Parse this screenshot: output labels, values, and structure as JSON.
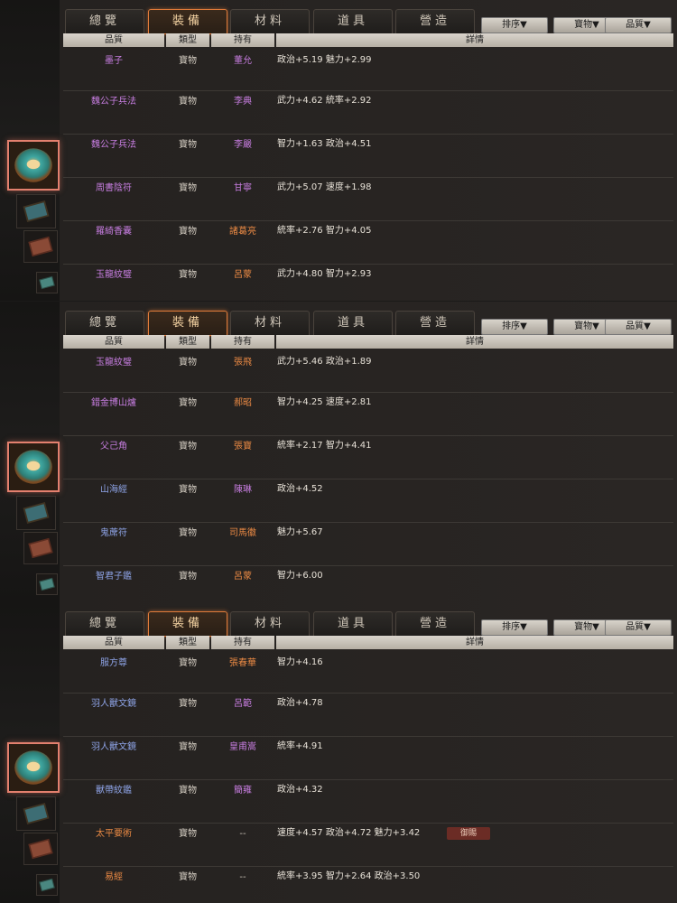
{
  "tabs": [
    "總覽",
    "裝備",
    "材料",
    "道具",
    "營造"
  ],
  "active_tab": 1,
  "filters": [
    "排序▼",
    "寶物▼",
    "品質▼"
  ],
  "headers": [
    "品質",
    "類型",
    "持有",
    "詳情"
  ],
  "colors": {
    "accent": "#e07b3a",
    "purple": "#c77de0",
    "blue": "#8ea3e6",
    "orange": "#eb8a44",
    "selection": "#e3806e"
  },
  "icons": [
    "jade-disc-icon",
    "book-icon",
    "book-brown-icon",
    "small-jade-icon"
  ],
  "panels": [
    {
      "rows": [
        {
          "name": "墨子",
          "name_q": "purple",
          "type": "寶物",
          "owner": "董允",
          "owner_q": "purple",
          "detail": "政治+5.19 魅力+2.99"
        },
        {
          "name": "魏公子兵法",
          "name_q": "purple",
          "type": "寶物",
          "owner": "李典",
          "owner_q": "purple",
          "detail": "武力+4.62 統率+2.92"
        },
        {
          "name": "魏公子兵法",
          "name_q": "purple",
          "type": "寶物",
          "owner": "李嚴",
          "owner_q": "purple",
          "detail": "智力+1.63 政治+4.51"
        },
        {
          "name": "周書陰符",
          "name_q": "purple",
          "type": "寶物",
          "owner": "甘寧",
          "owner_q": "purple",
          "detail": "武力+5.07 速度+1.98"
        },
        {
          "name": "羅綺香囊",
          "name_q": "purple",
          "type": "寶物",
          "owner": "諸葛亮",
          "owner_q": "orange",
          "detail": "統率+2.76 智力+4.05"
        },
        {
          "name": "玉龍紋璧",
          "name_q": "purple",
          "type": "寶物",
          "owner": "呂蒙",
          "owner_q": "orange",
          "detail": "武力+4.80 智力+2.93"
        }
      ]
    },
    {
      "rows": [
        {
          "name": "玉龍紋璧",
          "name_q": "purple",
          "type": "寶物",
          "owner": "張飛",
          "owner_q": "orange",
          "detail": "武力+5.46 政治+1.89"
        },
        {
          "name": "錯金博山爐",
          "name_q": "purple",
          "type": "寶物",
          "owner": "郝昭",
          "owner_q": "orange",
          "detail": "智力+4.25 速度+2.81"
        },
        {
          "name": "父己角",
          "name_q": "purple",
          "type": "寶物",
          "owner": "張寶",
          "owner_q": "orange",
          "detail": "統率+2.17 智力+4.41"
        },
        {
          "name": "山海經",
          "name_q": "blue",
          "type": "寶物",
          "owner": "陳琳",
          "owner_q": "purple",
          "detail": "政治+4.52"
        },
        {
          "name": "鬼蓆符",
          "name_q": "blue",
          "type": "寶物",
          "owner": "司馬徽",
          "owner_q": "orange",
          "detail": "魅力+5.67"
        },
        {
          "name": "智君子鑑",
          "name_q": "blue",
          "type": "寶物",
          "owner": "呂蒙",
          "owner_q": "orange",
          "detail": "智力+6.00"
        }
      ]
    },
    {
      "rows": [
        {
          "name": "服方尊",
          "name_q": "blue",
          "type": "寶物",
          "owner": "張春華",
          "owner_q": "orange",
          "detail": "智力+4.16"
        },
        {
          "name": "羽人獸文鏡",
          "name_q": "blue",
          "type": "寶物",
          "owner": "呂範",
          "owner_q": "purple",
          "detail": "政治+4.78"
        },
        {
          "name": "羽人獸文鏡",
          "name_q": "blue",
          "type": "寶物",
          "owner": "皇甫嵩",
          "owner_q": "purple",
          "detail": "統率+4.91"
        },
        {
          "name": "獸帶紋鑑",
          "name_q": "blue",
          "type": "寶物",
          "owner": "簡雍",
          "owner_q": "purple",
          "detail": "政治+4.32"
        },
        {
          "name": "太平要術",
          "name_q": "orange",
          "type": "寶物",
          "owner": "--",
          "owner_q": "gray",
          "detail": "速度+4.57 政治+4.72 魅力+3.42",
          "badge": "御賜"
        },
        {
          "name": "易經",
          "name_q": "orange",
          "type": "寶物",
          "owner": "--",
          "owner_q": "gray",
          "detail": "統率+3.95 智力+2.64 政治+3.50"
        }
      ]
    }
  ]
}
